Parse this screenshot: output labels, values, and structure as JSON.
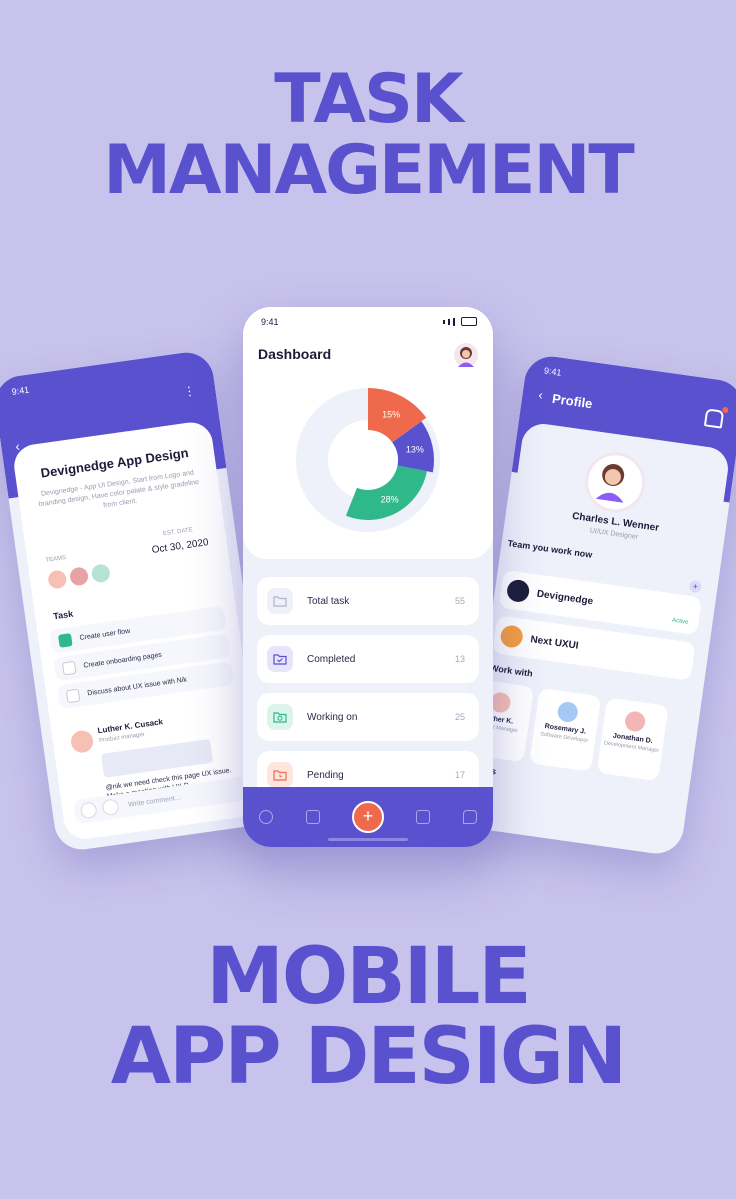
{
  "headline": {
    "line1": "TASK",
    "line2": "MANAGEMENT",
    "line3": "MOBILE",
    "line4": "APP DESIGN"
  },
  "colors": {
    "background": "#c8c3ec",
    "brand": "#5a51cf",
    "accent_orange": "#ef6a4c",
    "accent_green": "#2fb98a"
  },
  "left_phone": {
    "time": "9:41",
    "title": "Devignedge App Design",
    "description": "Devignedge - App UI Design, Start from Logo and branding design, Have color palate & style gradeline from client.",
    "teams_label": "TEAMS",
    "date_label": "EST. DATE",
    "date": "Oct 30, 2020",
    "task_heading": "Task",
    "tasks": [
      {
        "label": "Create user flow",
        "done": true
      },
      {
        "label": "Create onboarding pages",
        "done": false
      },
      {
        "label": "Discuss about UX issue with Nik",
        "done": false
      }
    ],
    "comment": {
      "name": "Luther K. Cusack",
      "role": "Product manager",
      "text": "@nik we need check this page UX issue. Make a meeting with UX D"
    },
    "input_placeholder": "Write comment..."
  },
  "center_phone": {
    "time": "9:41",
    "title": "Dashboard",
    "stats": [
      {
        "label": "Total task",
        "value": "55",
        "icon": "folder-icon"
      },
      {
        "label": "Completed",
        "value": "13",
        "icon": "folder-check-icon"
      },
      {
        "label": "Working on",
        "value": "25",
        "icon": "folder-refresh-icon"
      },
      {
        "label": "Pending",
        "value": "17",
        "icon": "folder-clock-icon"
      }
    ],
    "nav": [
      "grid-icon",
      "folder-check-icon",
      "add-icon",
      "box-icon",
      "chat-icon"
    ]
  },
  "chart_data": {
    "type": "pie",
    "categories": [
      "",
      "",
      ""
    ],
    "values": [
      15,
      13,
      28
    ],
    "labels": [
      "15%",
      "13%",
      "28%"
    ],
    "colors": [
      "#ef6a4c",
      "#5a51cf",
      "#2fb98a"
    ]
  },
  "right_phone": {
    "time": "9:41",
    "title": "Profile",
    "name": "Charles L. Wenner",
    "role": "UI/UX Designer",
    "teams_heading": "Team you work now",
    "teams": [
      {
        "name": "Devignedge",
        "status": "Active"
      },
      {
        "name": "Next UXUI",
        "status": ""
      }
    ],
    "work_with_heading": "Work with",
    "members": [
      {
        "name": "Luther K.",
        "role": "Product Manager"
      },
      {
        "name": "Rosemary J.",
        "role": "Software Developer"
      },
      {
        "name": "Jonathan D.",
        "role": "Development Manager"
      }
    ],
    "tags_heading": "Tags"
  }
}
